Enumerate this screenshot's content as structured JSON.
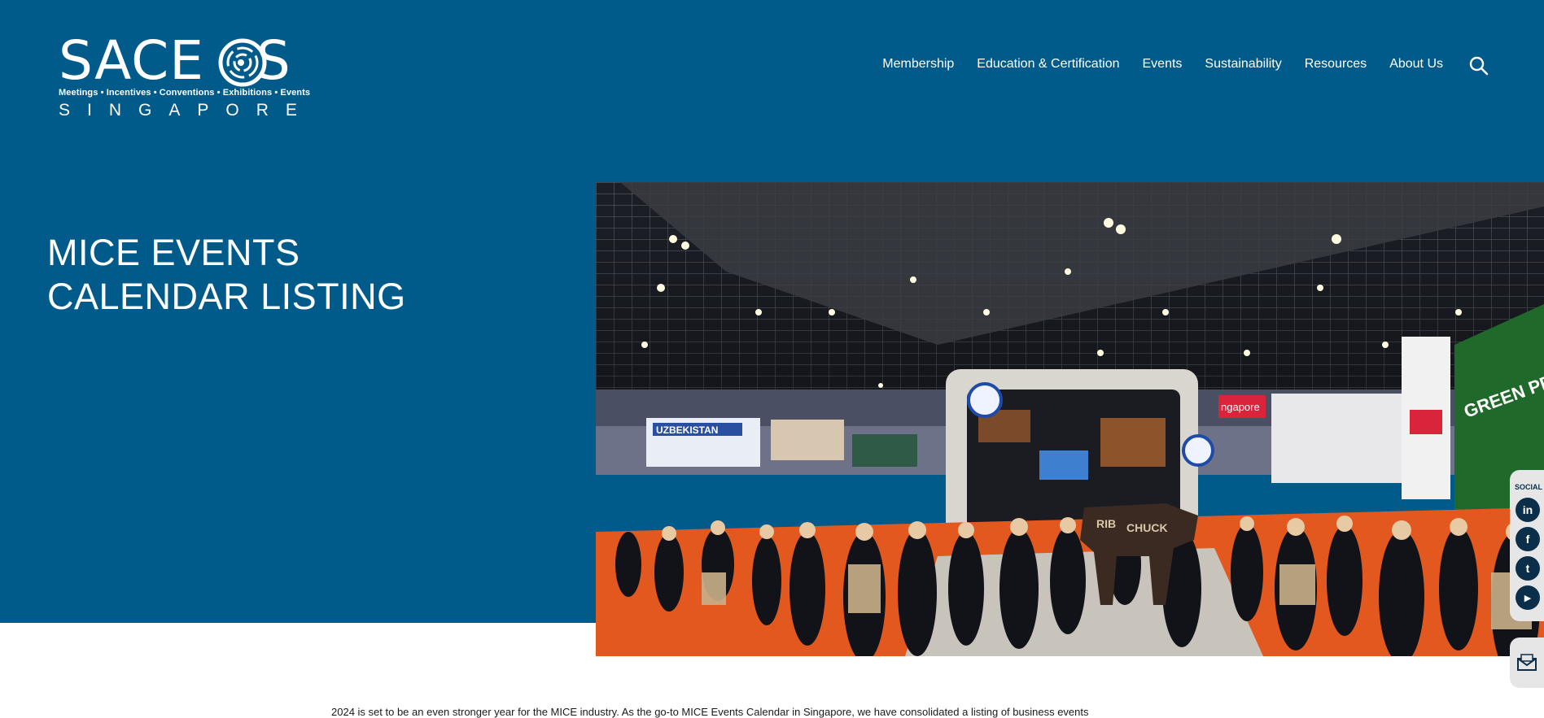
{
  "logo": {
    "word": "SACE",
    "word_tail": "S",
    "tagline": "Meetings • Incentives • Conventions • Exhibitions • Events",
    "country": "SINGAPORE"
  },
  "nav": {
    "items": [
      "Membership",
      "Education & Certification",
      "Events",
      "Sustainability",
      "Resources",
      "About Us"
    ]
  },
  "hero": {
    "title_line1": "MICE EVENTS",
    "title_line2": "CALENDAR LISTING",
    "image_signs": [
      "UZBEKISTAN",
      "CHUCK",
      "RIB",
      "GREEN PROTEIN",
      "ngapore"
    ]
  },
  "social": {
    "label": "SOCIAL",
    "buttons": [
      {
        "name": "linkedin",
        "glyph": "in"
      },
      {
        "name": "facebook",
        "glyph": "f"
      },
      {
        "name": "twitter",
        "glyph": "t"
      },
      {
        "name": "youtube",
        "glyph": "▶"
      }
    ]
  },
  "intro": {
    "text": "2024 is set to be an even stronger year for the MICE industry. As the go-to MICE Events Calendar in Singapore, we have consolidated a listing of business events"
  },
  "colors": {
    "primary": "#005b8a",
    "dark": "#0b2f4a",
    "carpet": "#e2581f"
  }
}
